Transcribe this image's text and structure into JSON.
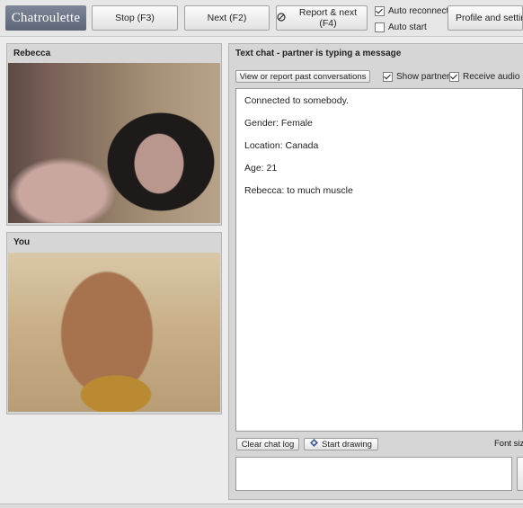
{
  "app": {
    "logo": "Chatroulette"
  },
  "toolbar": {
    "stop_label": "Stop (F3)",
    "next_label": "Next (F2)",
    "report_next_label": "Report & next (F4)",
    "auto_reconnect_label": "Auto reconnect",
    "auto_reconnect_checked": true,
    "auto_start_label": "Auto start",
    "auto_start_checked": false,
    "profile_label": "Profile and settings"
  },
  "partner_panel": {
    "title": "Rebecca"
  },
  "you_panel": {
    "title": "You"
  },
  "chat": {
    "header": "Text chat - partner is typing a message",
    "view_report_label": "View or report past conversations",
    "show_partner_label": "Show partner",
    "show_partner_checked": true,
    "receive_audio_label": "Receive audio",
    "receive_audio_checked": true,
    "messages": [
      "Connected to somebody.",
      "Gender: Female",
      "Location: Canada",
      "Age: 21",
      "Rebecca: to much muscle"
    ],
    "clear_label": "Clear chat log",
    "draw_label": "Start drawing",
    "font_size_label": "Font siz",
    "input_value": ""
  },
  "icons": {
    "report": "prohibited-icon",
    "draw": "diamond-icon"
  }
}
